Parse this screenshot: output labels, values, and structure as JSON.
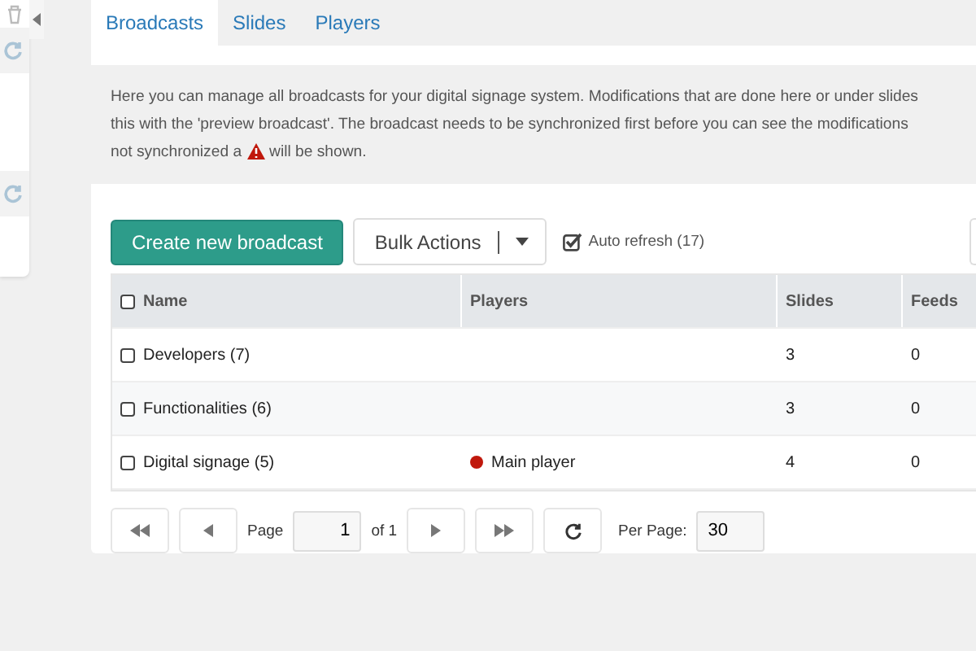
{
  "tabs": [
    {
      "label": "Broadcasts",
      "selected": true
    },
    {
      "label": "Slides",
      "selected": false
    },
    {
      "label": "Players",
      "selected": false
    }
  ],
  "info": {
    "before": "Here you can manage all broadcasts for your digital signage system. Modifications that are done here or under slides",
    "line2": "this with the 'preview broadcast'. The broadcast needs to be synchronized first before you can see the modifications",
    "before_icon": "not synchronized a",
    "after_icon": "will be shown."
  },
  "toolbar": {
    "create_button": "Create new broadcast",
    "bulk_actions": "Bulk Actions",
    "auto_refresh": {
      "label": "Auto refresh (17)",
      "checked": true
    }
  },
  "table": {
    "select_all_checked": false,
    "columns": [
      "Name",
      "Players",
      "Slides",
      "Feeds"
    ],
    "rows": [
      {
        "checked": false,
        "name": "Developers (7)",
        "players": [],
        "slides": "3",
        "feeds": "0"
      },
      {
        "checked": false,
        "name": "Functionalities (6)",
        "players": [],
        "slides": "3",
        "feeds": "0"
      },
      {
        "checked": false,
        "name": "Digital signage (5)",
        "players": [
          {
            "name": "Main player",
            "color": "#c0180c"
          }
        ],
        "slides": "4",
        "feeds": "0"
      }
    ]
  },
  "pagination": {
    "page_label": "Page",
    "page": "1",
    "of": "of 1",
    "per_page_label": "Per Page:",
    "per_page": "30"
  }
}
